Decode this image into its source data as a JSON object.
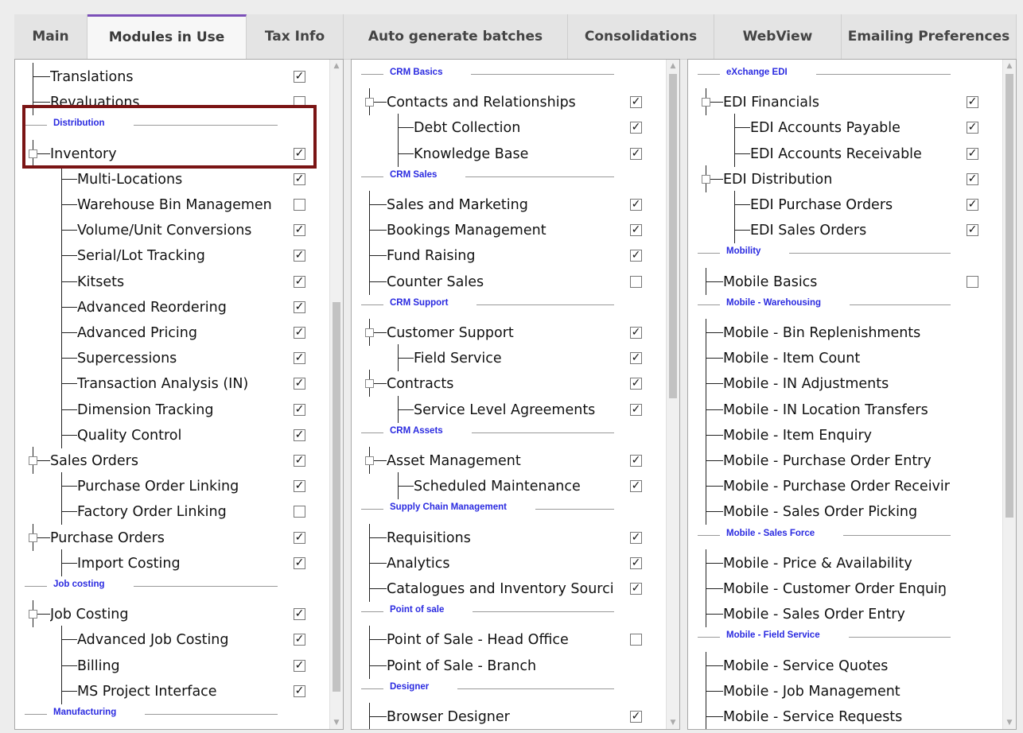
{
  "tabs": [
    {
      "label": "Main"
    },
    {
      "label": "Modules in Use",
      "active": true
    },
    {
      "label": "Tax Info"
    },
    {
      "label": "Auto generate batches"
    },
    {
      "label": "Consolidations"
    },
    {
      "label": "WebView"
    },
    {
      "label": "Emailing Preferences"
    }
  ],
  "colors": {
    "section_title": "#2a2ae0",
    "active_tab_accent": "#7b4fb8",
    "highlight_box": "#7a1414"
  },
  "panels": [
    {
      "rows": [
        {
          "type": "item",
          "level": 0,
          "label": "Translations",
          "checked": true
        },
        {
          "type": "item",
          "level": 0,
          "label": "Revaluations",
          "checked": false
        },
        {
          "type": "section",
          "label": "Distribution"
        },
        {
          "type": "item",
          "level": 0,
          "label": "Inventory",
          "checked": true,
          "expand": true
        },
        {
          "type": "item",
          "level": 1,
          "label": "Multi-Locations",
          "checked": true
        },
        {
          "type": "item",
          "level": 1,
          "label": "Warehouse Bin Managemen",
          "checked": false
        },
        {
          "type": "item",
          "level": 1,
          "label": "Volume/Unit Conversions",
          "checked": true
        },
        {
          "type": "item",
          "level": 1,
          "label": "Serial/Lot Tracking",
          "checked": true
        },
        {
          "type": "item",
          "level": 1,
          "label": "Kitsets",
          "checked": true
        },
        {
          "type": "item",
          "level": 1,
          "label": "Advanced Reordering",
          "checked": true
        },
        {
          "type": "item",
          "level": 1,
          "label": "Advanced Pricing",
          "checked": true
        },
        {
          "type": "item",
          "level": 1,
          "label": "Supercessions",
          "checked": true
        },
        {
          "type": "item",
          "level": 1,
          "label": "Transaction Analysis (IN)",
          "checked": true
        },
        {
          "type": "item",
          "level": 1,
          "label": "Dimension Tracking",
          "checked": true
        },
        {
          "type": "item",
          "level": 1,
          "label": "Quality Control",
          "checked": true
        },
        {
          "type": "item",
          "level": 0,
          "label": "Sales Orders",
          "checked": true,
          "expand": true
        },
        {
          "type": "item",
          "level": 1,
          "label": "Purchase Order Linking",
          "checked": true
        },
        {
          "type": "item",
          "level": 1,
          "label": "Factory Order Linking",
          "checked": false
        },
        {
          "type": "item",
          "level": 0,
          "label": "Purchase Orders",
          "checked": true,
          "expand": true
        },
        {
          "type": "item",
          "level": 1,
          "label": "Import Costing",
          "checked": true
        },
        {
          "type": "section",
          "label": "Job costing"
        },
        {
          "type": "item",
          "level": 0,
          "label": "Job Costing",
          "checked": true,
          "expand": true
        },
        {
          "type": "item",
          "level": 1,
          "label": "Advanced Job Costing",
          "checked": true
        },
        {
          "type": "item",
          "level": 1,
          "label": "Billing",
          "checked": true
        },
        {
          "type": "item",
          "level": 1,
          "label": "MS Project Interface",
          "checked": true
        },
        {
          "type": "section",
          "label": "Manufacturing"
        }
      ]
    },
    {
      "rows": [
        {
          "type": "section",
          "label": "CRM Basics"
        },
        {
          "type": "item",
          "level": 0,
          "label": "Contacts and Relationships",
          "checked": true,
          "expand": true
        },
        {
          "type": "item",
          "level": 1,
          "label": "Debt Collection",
          "checked": true
        },
        {
          "type": "item",
          "level": 1,
          "label": "Knowledge Base",
          "checked": true
        },
        {
          "type": "section",
          "label": "CRM Sales"
        },
        {
          "type": "item",
          "level": 0,
          "label": "Sales and Marketing",
          "checked": true
        },
        {
          "type": "item",
          "level": 0,
          "label": "Bookings Management",
          "checked": true
        },
        {
          "type": "item",
          "level": 0,
          "label": "Fund Raising",
          "checked": true
        },
        {
          "type": "item",
          "level": 0,
          "label": "Counter Sales",
          "checked": false
        },
        {
          "type": "section",
          "label": "CRM Support"
        },
        {
          "type": "item",
          "level": 0,
          "label": "Customer Support",
          "checked": true,
          "expand": true
        },
        {
          "type": "item",
          "level": 1,
          "label": "Field Service",
          "checked": true
        },
        {
          "type": "item",
          "level": 0,
          "label": "Contracts",
          "checked": true,
          "expand": true
        },
        {
          "type": "item",
          "level": 1,
          "label": "Service Level Agreements",
          "checked": true
        },
        {
          "type": "section",
          "label": "CRM Assets"
        },
        {
          "type": "item",
          "level": 0,
          "label": "Asset Management",
          "checked": true,
          "expand": true
        },
        {
          "type": "item",
          "level": 1,
          "label": "Scheduled Maintenance",
          "checked": true
        },
        {
          "type": "section",
          "label": "Supply Chain Management"
        },
        {
          "type": "item",
          "level": 0,
          "label": "Requisitions",
          "checked": true
        },
        {
          "type": "item",
          "level": 0,
          "label": "Analytics",
          "checked": true
        },
        {
          "type": "item",
          "level": 0,
          "label": "Catalogues and Inventory Sourci",
          "checked": true
        },
        {
          "type": "section",
          "label": "Point of sale"
        },
        {
          "type": "item",
          "level": 0,
          "label": "Point of Sale - Head Office",
          "checked": false
        },
        {
          "type": "item",
          "level": 0,
          "label": "Point of Sale - Branch",
          "checked": null
        },
        {
          "type": "section",
          "label": "Designer"
        },
        {
          "type": "item",
          "level": 0,
          "label": "Browser Designer",
          "checked": true
        }
      ]
    },
    {
      "rows": [
        {
          "type": "section",
          "label": "eXchange EDI"
        },
        {
          "type": "item",
          "level": 0,
          "label": "EDI Financials",
          "checked": true,
          "expand": true
        },
        {
          "type": "item",
          "level": 1,
          "label": "EDI Accounts Payable",
          "checked": true
        },
        {
          "type": "item",
          "level": 1,
          "label": "EDI Accounts Receivable",
          "checked": true
        },
        {
          "type": "item",
          "level": 0,
          "label": "EDI Distribution",
          "checked": true,
          "expand": true
        },
        {
          "type": "item",
          "level": 1,
          "label": "EDI Purchase Orders",
          "checked": true
        },
        {
          "type": "item",
          "level": 1,
          "label": "EDI Sales Orders",
          "checked": true
        },
        {
          "type": "section",
          "label": "Mobility"
        },
        {
          "type": "item",
          "level": 0,
          "label": "Mobile Basics",
          "checked": false
        },
        {
          "type": "section",
          "label": "Mobile - Warehousing"
        },
        {
          "type": "item",
          "level": 0,
          "label": "Mobile - Bin Replenishments",
          "checked": null
        },
        {
          "type": "item",
          "level": 0,
          "label": "Mobile - Item Count",
          "checked": null
        },
        {
          "type": "item",
          "level": 0,
          "label": "Mobile - IN Adjustments",
          "checked": null
        },
        {
          "type": "item",
          "level": 0,
          "label": "Mobile - IN Location Transfers",
          "checked": null
        },
        {
          "type": "item",
          "level": 0,
          "label": "Mobile - Item Enquiry",
          "checked": null
        },
        {
          "type": "item",
          "level": 0,
          "label": "Mobile - Purchase Order Entry",
          "checked": null
        },
        {
          "type": "item",
          "level": 0,
          "label": "Mobile - Purchase Order Receivir",
          "checked": null
        },
        {
          "type": "item",
          "level": 0,
          "label": "Mobile - Sales Order Picking",
          "checked": null
        },
        {
          "type": "section",
          "label": "Mobile - Sales Force"
        },
        {
          "type": "item",
          "level": 0,
          "label": "Mobile - Price & Availability",
          "checked": null
        },
        {
          "type": "item",
          "level": 0,
          "label": "Mobile - Customer Order Enquiŋ",
          "checked": null
        },
        {
          "type": "item",
          "level": 0,
          "label": "Mobile - Sales Order Entry",
          "checked": null
        },
        {
          "type": "section",
          "label": "Mobile - Field Service"
        },
        {
          "type": "item",
          "level": 0,
          "label": "Mobile - Service Quotes",
          "checked": null
        },
        {
          "type": "item",
          "level": 0,
          "label": "Mobile - Job Management",
          "checked": null
        },
        {
          "type": "item",
          "level": 0,
          "label": "Mobile - Service Requests",
          "checked": null
        }
      ]
    }
  ]
}
